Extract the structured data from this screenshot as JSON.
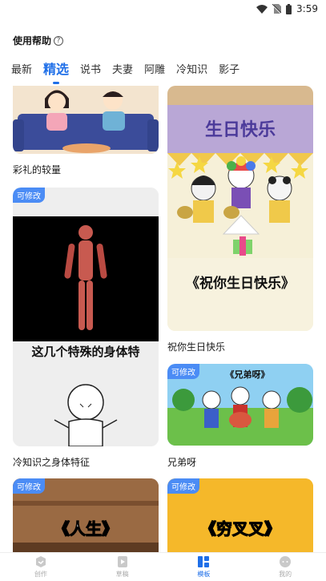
{
  "status_bar": {
    "time": "3:59"
  },
  "help": {
    "label": "使用帮助",
    "icon": "question-circle-icon"
  },
  "tabs": [
    {
      "label": "最新",
      "active": false
    },
    {
      "label": "精选",
      "active": true
    },
    {
      "label": "说书",
      "active": false
    },
    {
      "label": "夫妻",
      "active": false
    },
    {
      "label": "阿雕",
      "active": false
    },
    {
      "label": "冷知识",
      "active": false
    },
    {
      "label": "影子",
      "active": false
    }
  ],
  "feed": {
    "badge_label": "可修改",
    "cards": [
      {
        "title": "彩礼的较量"
      },
      {
        "title": "祝你生日快乐",
        "image_text": "生日快乐",
        "image_caption": "《祝你生日快乐》"
      },
      {
        "title": "冷知识之身体特征",
        "image_caption": "这几个特殊的身体特"
      },
      {
        "title": "兄弟呀",
        "image_caption": "《兄弟呀》"
      },
      {
        "title": "",
        "image_caption": "《人生》"
      },
      {
        "title": "",
        "image_caption": "《穷叉叉》"
      }
    ]
  },
  "bottom_nav": [
    {
      "label": "创作",
      "icon": "create-icon",
      "active": false
    },
    {
      "label": "草稿",
      "icon": "draft-icon",
      "active": false
    },
    {
      "label": "模板",
      "icon": "template-icon",
      "active": true
    },
    {
      "label": "我的",
      "icon": "profile-icon",
      "active": false
    }
  ],
  "colors": {
    "accent": "#1f6fe8",
    "badge": "#4b8cf5"
  }
}
